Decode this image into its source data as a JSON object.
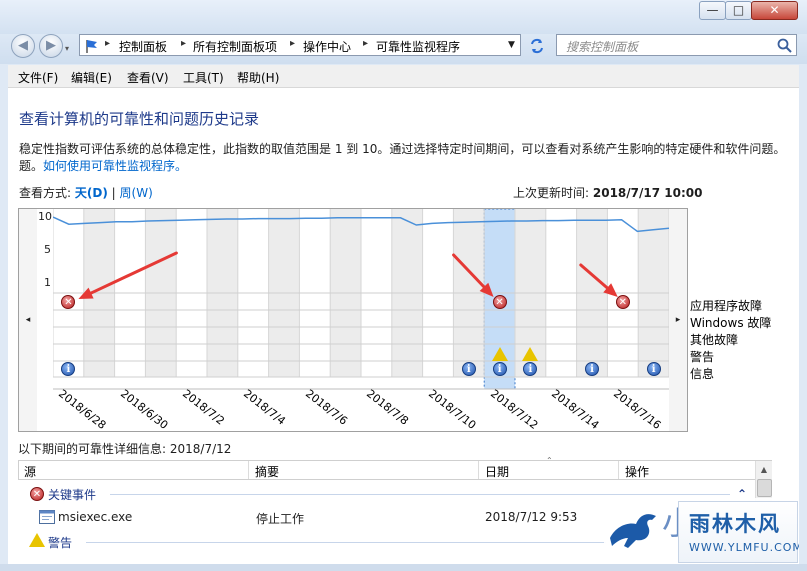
{
  "window": {
    "minimize_glyph": "—",
    "maximize_glyph": "□",
    "close_glyph": "✕"
  },
  "nav": {
    "back_glyph": "◀",
    "forward_glyph": "▶",
    "breadcrumbs": [
      "控制面板",
      "所有控制面板项",
      "操作中心",
      "可靠性监视程序"
    ],
    "search_placeholder": "搜索控制面板"
  },
  "menu": [
    "文件(F)",
    "编辑(E)",
    "查看(V)",
    "工具(T)",
    "帮助(H)"
  ],
  "page": {
    "title": "查看计算机的可靠性和问题历史记录",
    "description": "稳定性指数可评估系统的总体稳定性，此指数的取值范围是 1 到 10。通过选择特定时间期间，可以查看对系统产生影响的特定硬件和软件问题。",
    "description_tail": "题。",
    "help_link": "如何使用可靠性监视程序。",
    "view_by_label": "查看方式:",
    "view_day": "天(D)",
    "view_sep": "|",
    "view_week": "周(W)",
    "last_updated_label": "上次更新时间:",
    "last_updated_value": "2018/7/17 10:00"
  },
  "chart_data": {
    "type": "line",
    "y_ticks": [
      "10",
      "5",
      "1"
    ],
    "ylim": [
      1,
      10
    ],
    "x_labels": [
      "2018/6/28",
      "2018/6/30",
      "2018/7/2",
      "2018/7/4",
      "2018/7/6",
      "2018/7/8",
      "2018/7/10",
      "2018/7/12",
      "2018/7/14",
      "2018/7/16"
    ],
    "selected_day": "2018/7/12",
    "rows": [
      "应用程序故障",
      "Windows 故障",
      "其他故障",
      "警告",
      "信息"
    ],
    "stability_series": {
      "name": "",
      "values": [
        10,
        9.1,
        9.2,
        9.3,
        9.4,
        9.4,
        9.5,
        9.55,
        9.6,
        9.65,
        9.7,
        9.75,
        9.75,
        9.8,
        9.8,
        9.8,
        9.85,
        9.85,
        9.9,
        9.9,
        9.9,
        9.9,
        9.9,
        9.0,
        9.2,
        9.3,
        9.35,
        9.4,
        9.45,
        9.5,
        9.5,
        9.55,
        9.55,
        9.6,
        9.6,
        9.6,
        9.65,
        8.2,
        8.4,
        8.6
      ]
    },
    "events": {
      "app_failures": [
        "2018/6/28",
        "2018/7/12",
        "2018/7/16"
      ],
      "warnings": [
        "2018/7/12",
        "2018/7/13"
      ],
      "information": [
        "2018/6/28",
        "2018/7/11",
        "2018/7/12",
        "2018/7/13",
        "2018/7/15",
        "2018/7/17"
      ]
    },
    "grid": true,
    "scroll_left": "◂",
    "scroll_right": "▸"
  },
  "details": {
    "heading": "以下期间的可靠性详细信息: 2018/7/12",
    "columns": [
      "源",
      "摘要",
      "日期",
      "操作"
    ],
    "groups": [
      {
        "label": "关键事件",
        "collapse_glyph": "⌃"
      },
      {
        "label": "警告"
      }
    ],
    "rows": [
      {
        "source": "msiexec.exe",
        "summary": "停止工作",
        "date": "2018/7/12 9:53",
        "action": ""
      }
    ]
  },
  "watermark": {
    "text": "雨林木风",
    "url": "WWW.YLMFU.COM",
    "char": "小"
  },
  "colors": {
    "selected_column": "#c5ddf7",
    "stability_line": "#4a90d9",
    "arrow": "#e53935",
    "link": "#0066cc",
    "title": "#1e3a8a"
  }
}
